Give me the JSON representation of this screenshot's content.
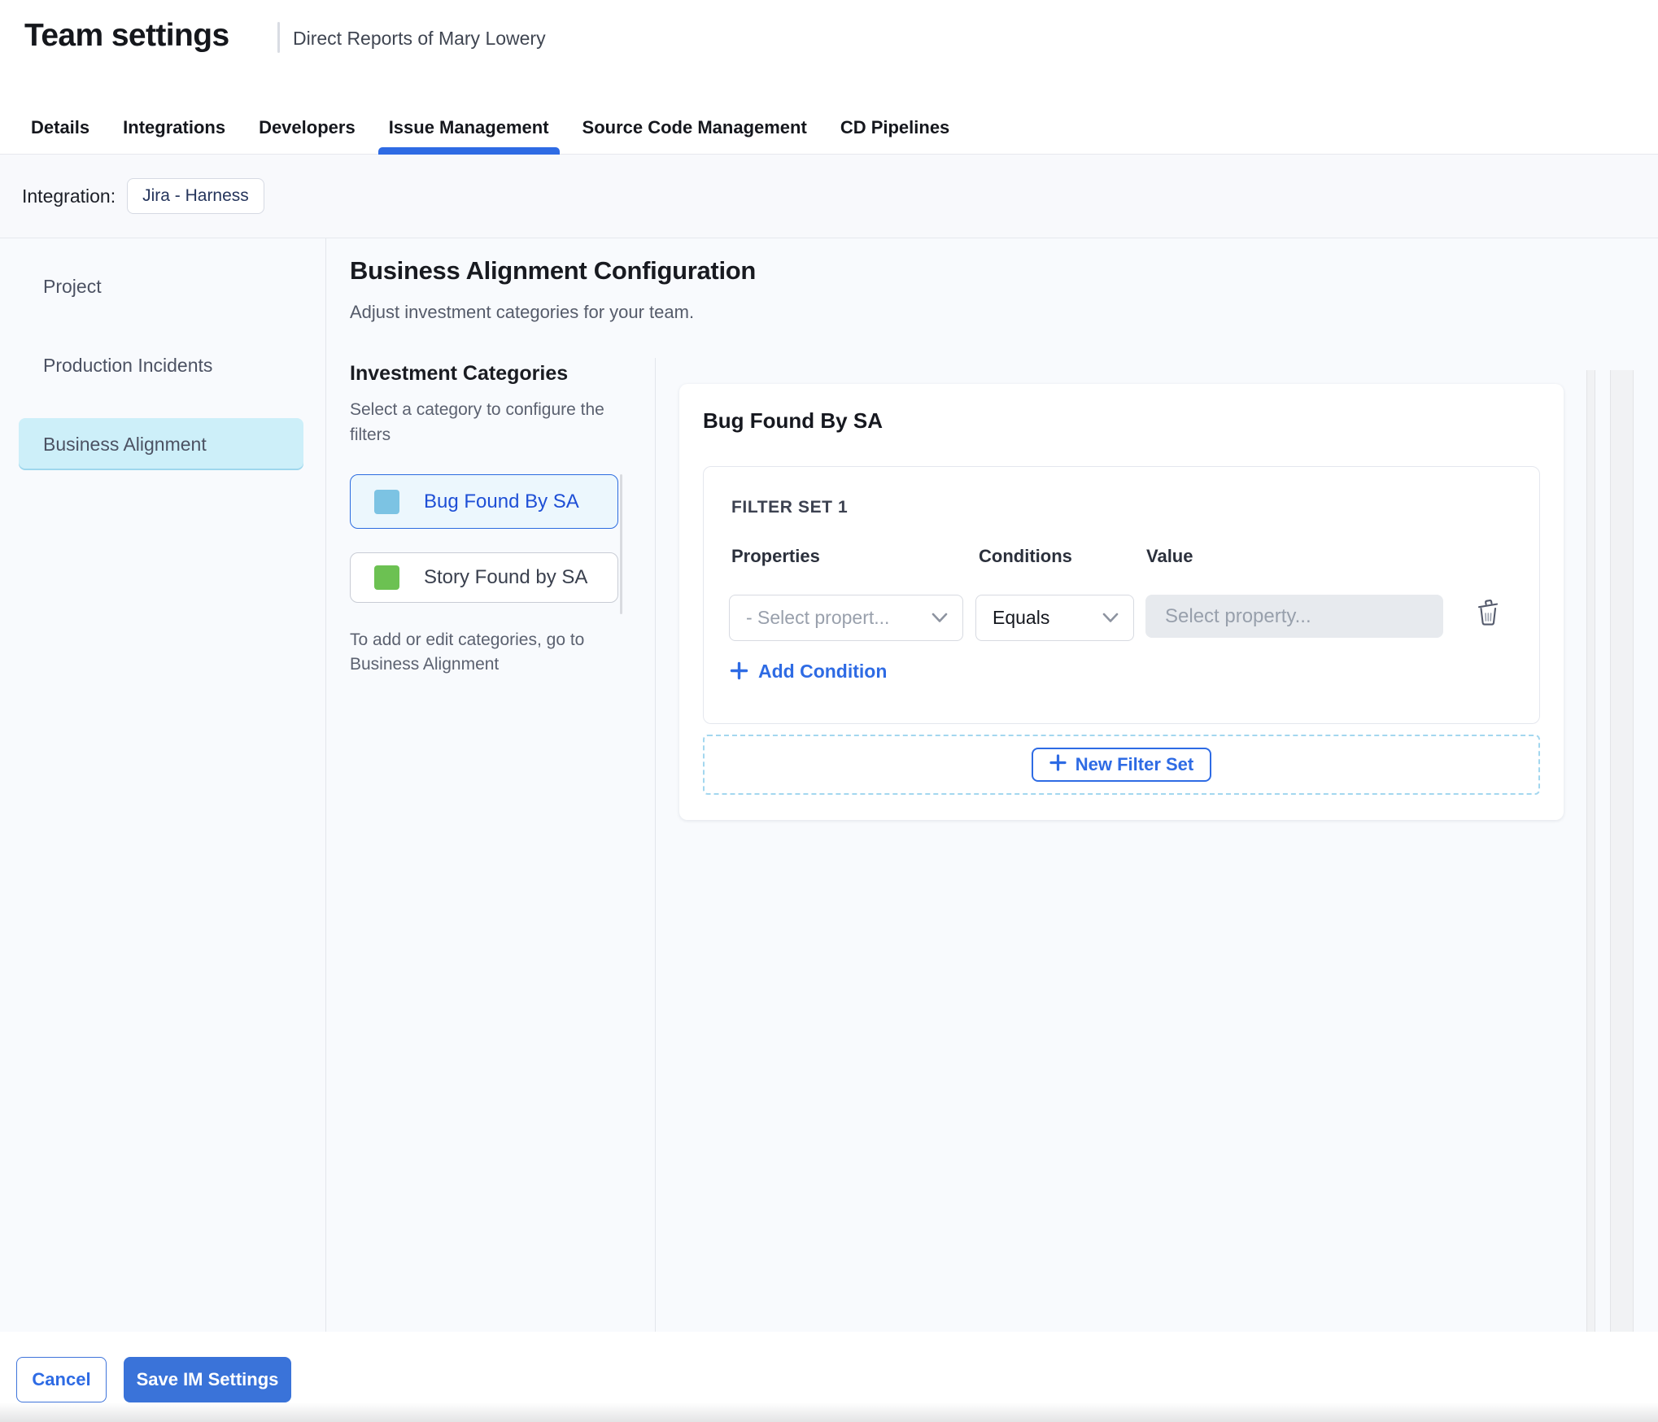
{
  "header": {
    "title": "Team settings",
    "subtitle": "Direct Reports of Mary Lowery"
  },
  "tabs": [
    {
      "label": "Details",
      "active": false
    },
    {
      "label": "Integrations",
      "active": false
    },
    {
      "label": "Developers",
      "active": false
    },
    {
      "label": "Issue Management",
      "active": true
    },
    {
      "label": "Source Code Management",
      "active": false
    },
    {
      "label": "CD Pipelines",
      "active": false
    }
  ],
  "integration": {
    "label": "Integration:",
    "chip": "Jira - Harness"
  },
  "sidebar": {
    "items": [
      {
        "label": "Project",
        "selected": false
      },
      {
        "label": "Production Incidents",
        "selected": false
      },
      {
        "label": "Business Alignment",
        "selected": true
      }
    ]
  },
  "main": {
    "title": "Business Alignment Configuration",
    "subtitle": "Adjust investment categories for your team.",
    "categories": {
      "heading": "Investment Categories",
      "hint": "Select a category to configure the filters",
      "items": [
        {
          "label": "Bug Found By SA",
          "swatch_color": "#7cc3e3",
          "selected": true
        },
        {
          "label": "Story Found by SA",
          "swatch_color": "#6cc152",
          "selected": false
        }
      ],
      "footnote": "To add or edit categories, go to Business Alignment"
    },
    "panel": {
      "title": "Bug Found By SA",
      "filter_set": {
        "heading": "FILTER SET 1",
        "columns": [
          "Properties",
          "Conditions",
          "Value"
        ],
        "property_placeholder": "- Select propert...",
        "condition_value": "Equals",
        "value_placeholder": "Select property...",
        "add_condition_label": "Add Condition"
      },
      "new_filter_set_label": "New Filter Set"
    }
  },
  "footer": {
    "cancel_label": "Cancel",
    "save_label": "Save IM Settings"
  },
  "colors": {
    "accent_blue": "#2e6be4",
    "selected_nav_bg": "#cdeff9",
    "category_selected_bg": "#ecf7fd",
    "category_selected_text": "#1e4fd6",
    "bug_swatch": "#7cc3e3",
    "story_swatch": "#6cc152",
    "save_button_bg": "#3a73d9",
    "dashed_border": "#a3d7ef",
    "value_field_bg": "#e7eaee"
  }
}
